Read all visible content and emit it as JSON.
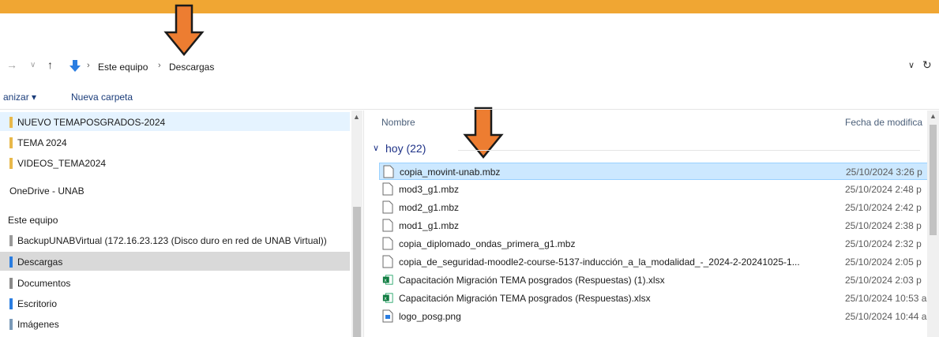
{
  "colors": {
    "banner": "#f0a633",
    "arrow": "#ed7d31",
    "selection": "#cce8ff"
  },
  "address": {
    "back_icon": "back-arrow-icon",
    "forward_icon": "forward-arrow-icon",
    "up_icon": "up-arrow-icon",
    "crumbs": [
      "Este equipo",
      "Descargas"
    ]
  },
  "toolbar": {
    "organize": "anizar ▾",
    "new_folder": "Nueva carpeta"
  },
  "nav": {
    "items": [
      {
        "label": "NUEVO TEMAPOSGRADOS-2024",
        "icon": "folder-icon"
      },
      {
        "label": "TEMA 2024",
        "icon": "folder-icon"
      },
      {
        "label": "VIDEOS_TEMA2024",
        "icon": "folder-icon"
      },
      {
        "label": "OneDrive - UNAB",
        "icon": ""
      },
      {
        "label": "Este equipo",
        "icon": ""
      },
      {
        "label": "BackupUNABVirtual (172.16.23.123 (Disco duro en red de UNAB Virtual))",
        "icon": "network-drive-icon"
      },
      {
        "label": "Descargas",
        "icon": "downloads-icon"
      },
      {
        "label": "Documentos",
        "icon": "documents-icon"
      },
      {
        "label": "Escritorio",
        "icon": "desktop-icon"
      },
      {
        "label": "Imágenes",
        "icon": "pictures-icon"
      }
    ]
  },
  "files": {
    "columns": {
      "name": "Nombre",
      "date": "Fecha de modifica"
    },
    "group": "hoy (22)",
    "rows": [
      {
        "name": "copia_movint-unab.mbz",
        "date": "25/10/2024 3:26 p",
        "type": "file"
      },
      {
        "name": "mod3_g1.mbz",
        "date": "25/10/2024 2:48 p",
        "type": "file"
      },
      {
        "name": "mod2_g1.mbz",
        "date": "25/10/2024 2:42 p",
        "type": "file"
      },
      {
        "name": "mod1_g1.mbz",
        "date": "25/10/2024 2:38 p",
        "type": "file"
      },
      {
        "name": "copia_diplomado_ondas_primera_g1.mbz",
        "date": "25/10/2024 2:32 p",
        "type": "file"
      },
      {
        "name": "copia_de_seguridad-moodle2-course-5137-inducción_a_la_modalidad_-_2024-2-20241025-1...",
        "date": "25/10/2024 2:05 p",
        "type": "file"
      },
      {
        "name": "Capacitación Migración TEMA posgrados (Respuestas) (1).xlsx",
        "date": "25/10/2024 2:03 p",
        "type": "excel"
      },
      {
        "name": "Capacitación Migración TEMA posgrados (Respuestas).xlsx",
        "date": "25/10/2024 10:53 a",
        "type": "excel"
      },
      {
        "name": "logo_posg.png",
        "date": "25/10/2024 10:44 a",
        "type": "image"
      }
    ]
  }
}
